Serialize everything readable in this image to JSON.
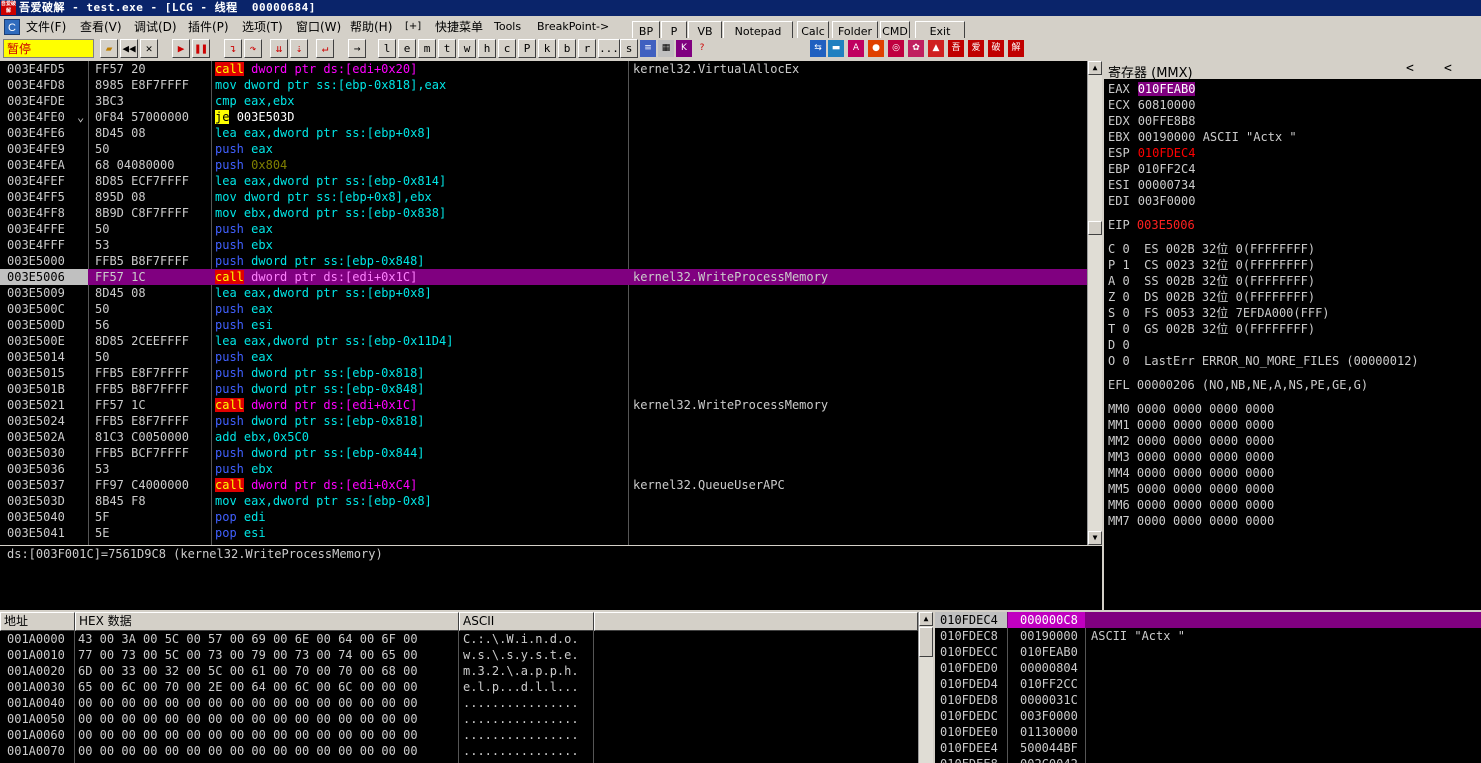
{
  "window": {
    "icon_text": "吾爱破解",
    "title": "吾爱破解 - test.exe - [LCG - 线程  00000684]"
  },
  "menu": {
    "icon": "C",
    "items": [
      "文件(F)",
      "查看(V)",
      "调试(D)",
      "插件(P)",
      "选项(T)",
      "窗口(W)",
      "帮助(H)",
      "[+]",
      "快捷菜单",
      "Tools",
      "BreakPoint->"
    ]
  },
  "plugin_buttons": [
    "BP",
    "P",
    "VB",
    "Notepad",
    "Calc",
    "Folder",
    "CMD",
    "Exit"
  ],
  "toolbar": {
    "status": "暂停",
    "letters": [
      "l",
      "e",
      "m",
      "t",
      "w",
      "h",
      "c",
      "P",
      "k",
      "b",
      "r",
      "...",
      "s"
    ],
    "icons": [
      "open-icon",
      "restart-icon",
      "close-icon",
      "run-icon",
      "pause-icon",
      "step-into-icon",
      "step-over-icon",
      "trace-into-icon",
      "trace-over-icon",
      "execute-till-return-icon",
      "goto-icon"
    ]
  },
  "disasm": {
    "rows": [
      {
        "addr": "003E4FD5",
        "hex": "FF57 20",
        "mnem": "call",
        "ops": "dword ptr ds:[edi+0x20]",
        "cmt": "kernel32.VirtualAllocEx",
        "kind": "call"
      },
      {
        "addr": "003E4FD8",
        "hex": "8985 E8F7FFFF",
        "mnem": "mov",
        "ops": "dword ptr ss:[ebp-0x818],eax",
        "cmt": "",
        "kind": "mov"
      },
      {
        "addr": "003E4FDE",
        "hex": "3BC3",
        "mnem": "cmp",
        "ops": "eax,ebx",
        "cmt": "",
        "kind": "cmp"
      },
      {
        "addr": "003E4FE0",
        "hex": "0F84 57000000",
        "mnem": "je",
        "ops": "003E503D",
        "cmt": "",
        "kind": "jump",
        "marker": "⌄"
      },
      {
        "addr": "003E4FE6",
        "hex": "8D45 08",
        "mnem": "lea",
        "ops": "eax,dword ptr ss:[ebp+0x8]",
        "cmt": "",
        "kind": "mov"
      },
      {
        "addr": "003E4FE9",
        "hex": "50",
        "mnem": "push",
        "ops": "eax",
        "cmt": "",
        "kind": "push"
      },
      {
        "addr": "003E4FEA",
        "hex": "68 04080000",
        "mnem": "push",
        "ops": "0x804",
        "cmt": "",
        "kind": "push-imm"
      },
      {
        "addr": "003E4FEF",
        "hex": "8D85 ECF7FFFF",
        "mnem": "lea",
        "ops": "eax,dword ptr ss:[ebp-0x814]",
        "cmt": "",
        "kind": "mov"
      },
      {
        "addr": "003E4FF5",
        "hex": "895D 08",
        "mnem": "mov",
        "ops": "dword ptr ss:[ebp+0x8],ebx",
        "cmt": "",
        "kind": "mov"
      },
      {
        "addr": "003E4FF8",
        "hex": "8B9D C8F7FFFF",
        "mnem": "mov",
        "ops": "ebx,dword ptr ss:[ebp-0x838]",
        "cmt": "",
        "kind": "mov"
      },
      {
        "addr": "003E4FFE",
        "hex": "50",
        "mnem": "push",
        "ops": "eax",
        "cmt": "",
        "kind": "push"
      },
      {
        "addr": "003E4FFF",
        "hex": "53",
        "mnem": "push",
        "ops": "ebx",
        "cmt": "",
        "kind": "push"
      },
      {
        "addr": "003E5000",
        "hex": "FFB5 B8F7FFFF",
        "mnem": "push",
        "ops": "dword ptr ss:[ebp-0x848]",
        "cmt": "",
        "kind": "push"
      },
      {
        "addr": "003E5006",
        "hex": "FF57 1C",
        "mnem": "call",
        "ops": "dword ptr ds:[edi+0x1C]",
        "cmt": "kernel32.WriteProcessMemory",
        "kind": "call",
        "selected": true
      },
      {
        "addr": "003E5009",
        "hex": "8D45 08",
        "mnem": "lea",
        "ops": "eax,dword ptr ss:[ebp+0x8]",
        "cmt": "",
        "kind": "mov"
      },
      {
        "addr": "003E500C",
        "hex": "50",
        "mnem": "push",
        "ops": "eax",
        "cmt": "",
        "kind": "push"
      },
      {
        "addr": "003E500D",
        "hex": "56",
        "mnem": "push",
        "ops": "esi",
        "cmt": "",
        "kind": "push"
      },
      {
        "addr": "003E500E",
        "hex": "8D85 2CEEFFFF",
        "mnem": "lea",
        "ops": "eax,dword ptr ss:[ebp-0x11D4]",
        "cmt": "",
        "kind": "mov"
      },
      {
        "addr": "003E5014",
        "hex": "50",
        "mnem": "push",
        "ops": "eax",
        "cmt": "",
        "kind": "push"
      },
      {
        "addr": "003E5015",
        "hex": "FFB5 E8F7FFFF",
        "mnem": "push",
        "ops": "dword ptr ss:[ebp-0x818]",
        "cmt": "",
        "kind": "push"
      },
      {
        "addr": "003E501B",
        "hex": "FFB5 B8F7FFFF",
        "mnem": "push",
        "ops": "dword ptr ss:[ebp-0x848]",
        "cmt": "",
        "kind": "push"
      },
      {
        "addr": "003E5021",
        "hex": "FF57 1C",
        "mnem": "call",
        "ops": "dword ptr ds:[edi+0x1C]",
        "cmt": "kernel32.WriteProcessMemory",
        "kind": "call"
      },
      {
        "addr": "003E5024",
        "hex": "FFB5 E8F7FFFF",
        "mnem": "push",
        "ops": "dword ptr ss:[ebp-0x818]",
        "cmt": "",
        "kind": "push"
      },
      {
        "addr": "003E502A",
        "hex": "81C3 C0050000",
        "mnem": "add",
        "ops": "ebx,0x5C0",
        "cmt": "",
        "kind": "add"
      },
      {
        "addr": "003E5030",
        "hex": "FFB5 BCF7FFFF",
        "mnem": "push",
        "ops": "dword ptr ss:[ebp-0x844]",
        "cmt": "",
        "kind": "push"
      },
      {
        "addr": "003E5036",
        "hex": "53",
        "mnem": "push",
        "ops": "ebx",
        "cmt": "",
        "kind": "push"
      },
      {
        "addr": "003E5037",
        "hex": "FF97 C4000000",
        "mnem": "call",
        "ops": "dword ptr ds:[edi+0xC4]",
        "cmt": "kernel32.QueueUserAPC",
        "kind": "call"
      },
      {
        "addr": "003E503D",
        "hex": "8B45 F8",
        "mnem": "mov",
        "ops": "eax,dword ptr ss:[ebp-0x8]",
        "cmt": "",
        "kind": "mov"
      },
      {
        "addr": "003E5040",
        "hex": "5F",
        "mnem": "pop",
        "ops": "edi",
        "cmt": "",
        "kind": "push"
      },
      {
        "addr": "003E5041",
        "hex": "5E",
        "mnem": "pop",
        "ops": "esi",
        "cmt": "",
        "kind": "push"
      }
    ]
  },
  "info_line": "ds:[003F001C]=7561D9C8 (kernel32.WriteProcessMemory)",
  "registers": {
    "title": "寄存器 (MMX)",
    "nav": [
      "<",
      "<"
    ],
    "gp": [
      {
        "name": "EAX",
        "value": "010FEAB0",
        "extra": "",
        "style": "hl"
      },
      {
        "name": "ECX",
        "value": "60810000",
        "extra": "",
        "style": ""
      },
      {
        "name": "EDX",
        "value": "00FFE8B8",
        "extra": "",
        "style": ""
      },
      {
        "name": "EBX",
        "value": "00190000",
        "extra": " ASCII \"Actx \"",
        "style": ""
      },
      {
        "name": "ESP",
        "value": "010FDEC4",
        "extra": "",
        "style": "red"
      },
      {
        "name": "EBP",
        "value": "010FF2C4",
        "extra": "",
        "style": ""
      },
      {
        "name": "ESI",
        "value": "00000734",
        "extra": "",
        "style": ""
      },
      {
        "name": "EDI",
        "value": "003F0000",
        "extra": "",
        "style": ""
      }
    ],
    "eip": {
      "name": "EIP",
      "value": "003E5006"
    },
    "flags": [
      "C 0  ES 002B 32位 0(FFFFFFFF)",
      "P 1  CS 0023 32位 0(FFFFFFFF)",
      "A 0  SS 002B 32位 0(FFFFFFFF)",
      "Z 0  DS 002B 32位 0(FFFFFFFF)",
      "S 0  FS 0053 32位 7EFDA000(FFF)",
      "T 0  GS 002B 32位 0(FFFFFFFF)",
      "D 0",
      "O 0  LastErr ERROR_NO_MORE_FILES (00000012)"
    ],
    "efl": "EFL 00000206 (NO,NB,NE,A,NS,PE,GE,G)",
    "mmx": [
      "MM0 0000 0000 0000 0000",
      "MM1 0000 0000 0000 0000",
      "MM2 0000 0000 0000 0000",
      "MM3 0000 0000 0000 0000",
      "MM4 0000 0000 0000 0000",
      "MM5 0000 0000 0000 0000",
      "MM6 0000 0000 0000 0000",
      "MM7 0000 0000 0000 0000"
    ]
  },
  "dump": {
    "headers": [
      "地址",
      "HEX 数据",
      "ASCII"
    ],
    "rows": [
      {
        "addr": "001A0000",
        "hex": "43 00 3A 00 5C 00 57 00 69 00 6E 00 64 00 6F 00",
        "ascii": "C.:.\\.W.i.n.d.o."
      },
      {
        "addr": "001A0010",
        "hex": "77 00 73 00 5C 00 73 00 79 00 73 00 74 00 65 00",
        "ascii": "w.s.\\.s.y.s.t.e."
      },
      {
        "addr": "001A0020",
        "hex": "6D 00 33 00 32 00 5C 00 61 00 70 00 70 00 68 00",
        "ascii": "m.3.2.\\.a.p.p.h."
      },
      {
        "addr": "001A0030",
        "hex": "65 00 6C 00 70 00 2E 00 64 00 6C 00 6C 00 00 00",
        "ascii": "e.l.p...d.l.l..."
      },
      {
        "addr": "001A0040",
        "hex": "00 00 00 00 00 00 00 00 00 00 00 00 00 00 00 00",
        "ascii": "................"
      },
      {
        "addr": "001A0050",
        "hex": "00 00 00 00 00 00 00 00 00 00 00 00 00 00 00 00",
        "ascii": "................"
      },
      {
        "addr": "001A0060",
        "hex": "00 00 00 00 00 00 00 00 00 00 00 00 00 00 00 00",
        "ascii": "................"
      },
      {
        "addr": "001A0070",
        "hex": "00 00 00 00 00 00 00 00 00 00 00 00 00 00 00 00",
        "ascii": "................"
      }
    ]
  },
  "stack": {
    "top": {
      "addr": "010FDEC4",
      "value": "000000C8"
    },
    "rows": [
      {
        "addr": "010FDEC8",
        "value": "00190000",
        "cmt": "ASCII \"Actx \""
      },
      {
        "addr": "010FDECC",
        "value": "010FEAB0",
        "cmt": ""
      },
      {
        "addr": "010FDED0",
        "value": "00000804",
        "cmt": ""
      },
      {
        "addr": "010FDED4",
        "value": "010FF2CC",
        "cmt": ""
      },
      {
        "addr": "010FDED8",
        "value": "0000031C",
        "cmt": ""
      },
      {
        "addr": "010FDEDC",
        "value": "003F0000",
        "cmt": ""
      },
      {
        "addr": "010FDEE0",
        "value": "01130000",
        "cmt": ""
      },
      {
        "addr": "010FDEE4",
        "value": "500044BF",
        "cmt": ""
      },
      {
        "addr": "010FDEE8",
        "value": "002C0042",
        "cmt": ""
      }
    ]
  },
  "colors": {
    "call_bg": "#e00000",
    "call_fg": "#ffff00",
    "mov": "#00e6e6",
    "push": "#4060ff",
    "imm": "#808000",
    "jump_bg": "#ffff00",
    "mem": "#ff00ff",
    "selected_bg": "#800080",
    "red": "#ff0000",
    "hl_bg": "#800080"
  }
}
